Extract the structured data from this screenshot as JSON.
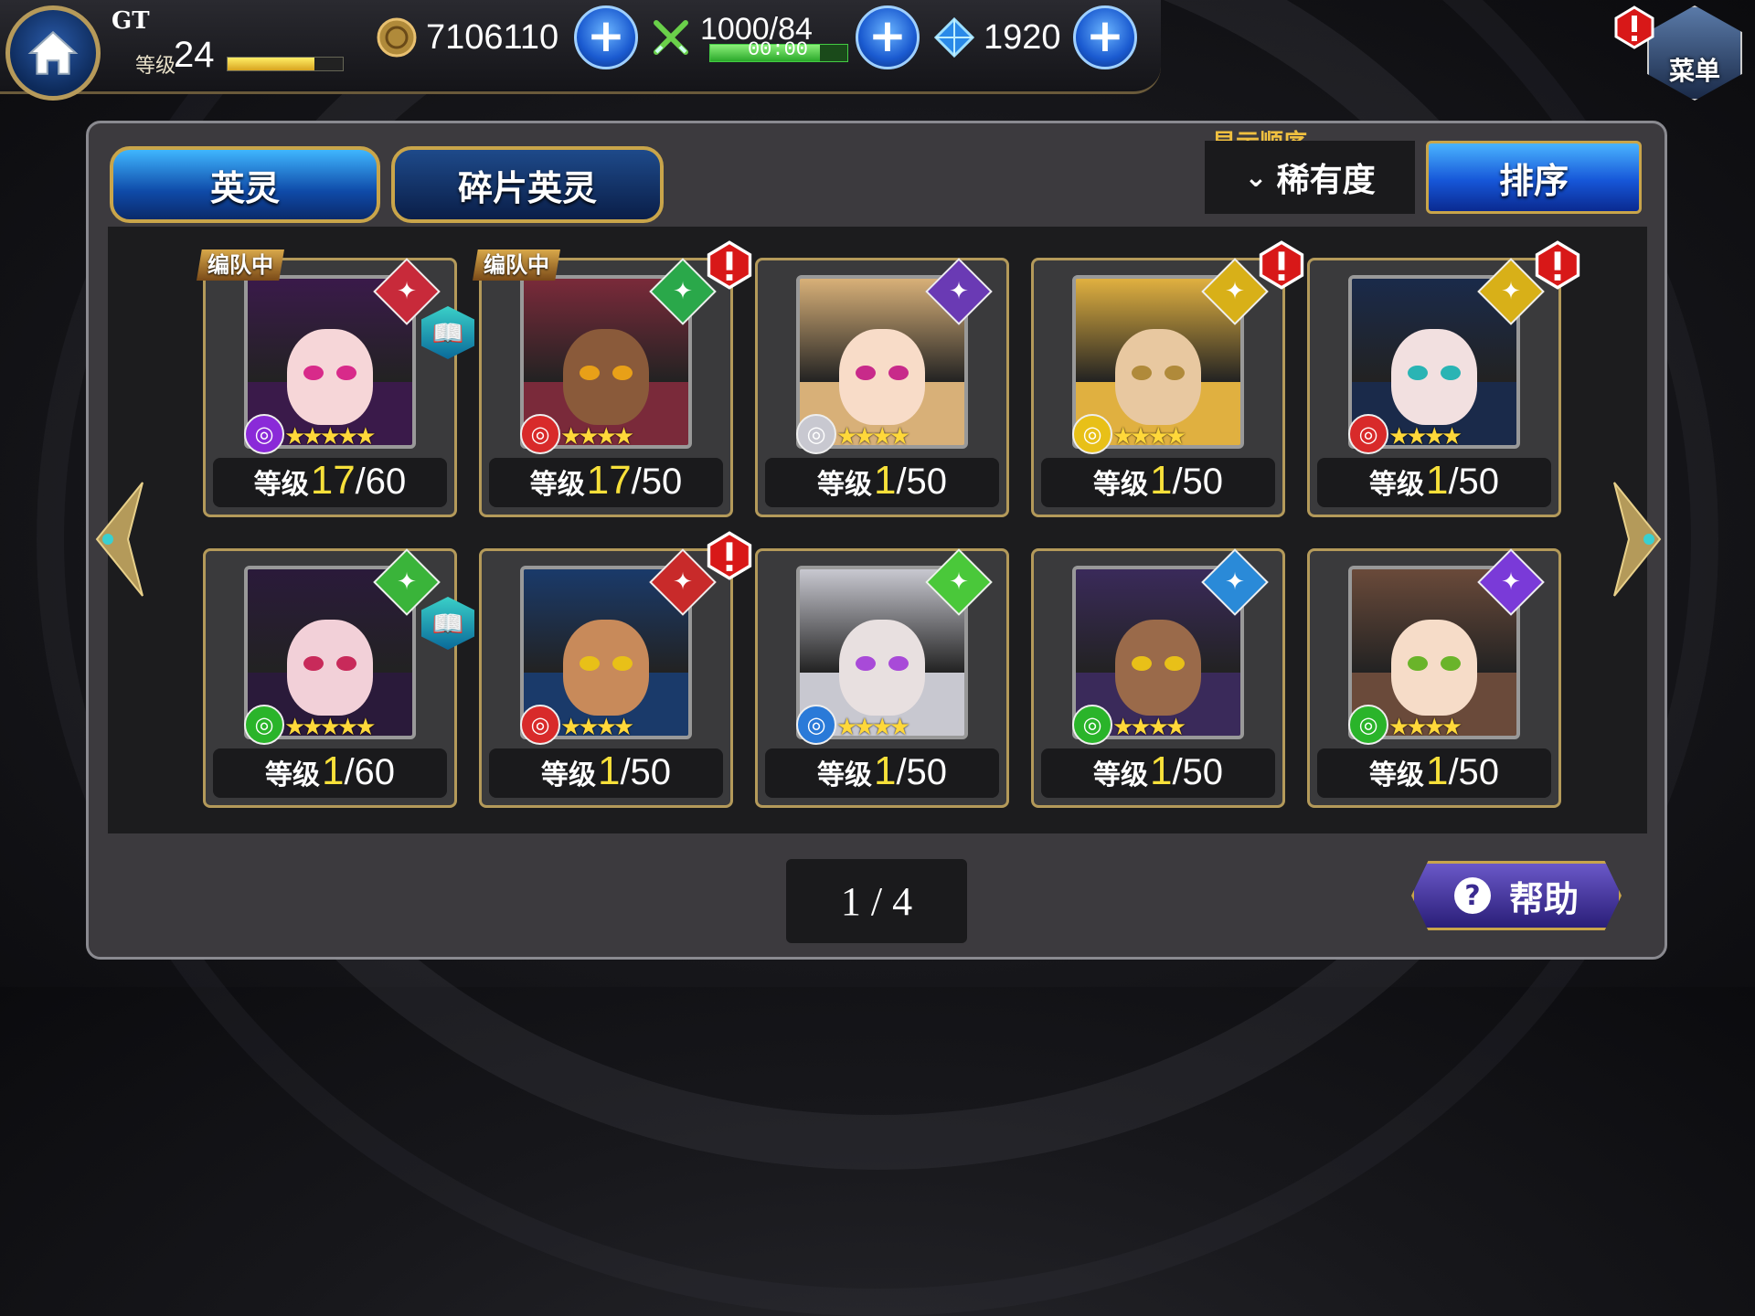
{
  "header": {
    "player_name": "GT",
    "level_label": "等级",
    "level_value": "24",
    "exp_fraction": 0.75,
    "gold": "7106110",
    "stamina": "1000/84",
    "stamina_timer": "00:00",
    "gems": "1920",
    "menu_label": "菜单",
    "plus_symbol": "+"
  },
  "tabs": {
    "heroes": "英灵",
    "fragments": "碎片英灵"
  },
  "sort": {
    "caption": "显示顺序",
    "current": "稀有度",
    "button": "排序"
  },
  "cards": [
    {
      "level_label": "等级",
      "level": "17",
      "max": "/60",
      "stars": "★★★★★",
      "attr": "purple",
      "in_team": "编队中",
      "alert": false,
      "book": true
    },
    {
      "level_label": "等级",
      "level": "17",
      "max": "/50",
      "stars": "★★★★",
      "attr": "red",
      "in_team": "编队中",
      "alert": true,
      "book": false
    },
    {
      "level_label": "等级",
      "level": "1",
      "max": "/50",
      "stars": "★★★★",
      "attr": "white",
      "in_team": "",
      "alert": false,
      "book": false
    },
    {
      "level_label": "等级",
      "level": "1",
      "max": "/50",
      "stars": "★★★★",
      "attr": "yellow",
      "in_team": "",
      "alert": true,
      "book": false
    },
    {
      "level_label": "等级",
      "level": "1",
      "max": "/50",
      "stars": "★★★★",
      "attr": "red",
      "in_team": "",
      "alert": true,
      "book": false
    },
    {
      "level_label": "等级",
      "level": "1",
      "max": "/60",
      "stars": "★★★★★",
      "attr": "green",
      "in_team": "",
      "alert": false,
      "book": true
    },
    {
      "level_label": "等级",
      "level": "1",
      "max": "/50",
      "stars": "★★★★",
      "attr": "red",
      "in_team": "",
      "alert": true,
      "book": false
    },
    {
      "level_label": "等级",
      "level": "1",
      "max": "/50",
      "stars": "★★★★",
      "attr": "blue",
      "in_team": "",
      "alert": false,
      "book": false
    },
    {
      "level_label": "等级",
      "level": "1",
      "max": "/50",
      "stars": "★★★★",
      "attr": "green",
      "in_team": "",
      "alert": false,
      "book": false
    },
    {
      "level_label": "等级",
      "level": "1",
      "max": "/50",
      "stars": "★★★★",
      "attr": "green",
      "in_team": "",
      "alert": false,
      "book": false
    }
  ],
  "pager": "1 / 4",
  "help": "帮助"
}
